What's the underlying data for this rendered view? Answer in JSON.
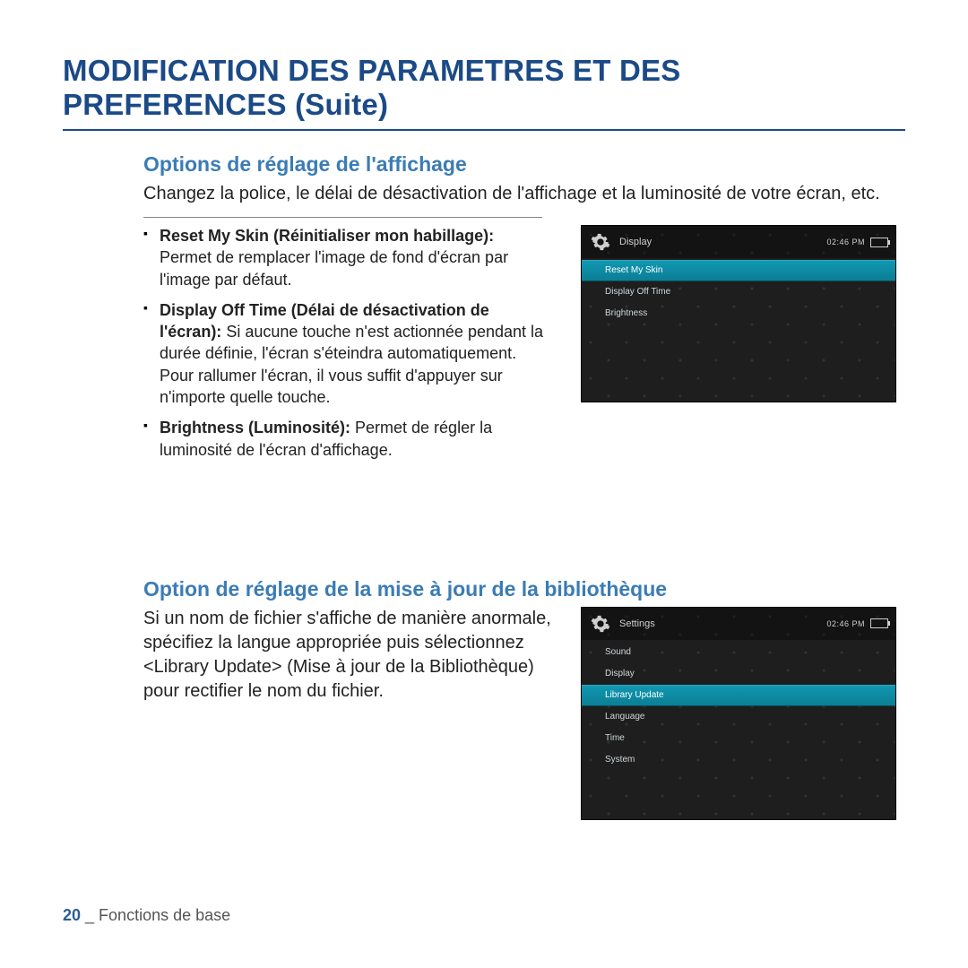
{
  "page_title": "MODIFICATION DES PARAMETRES ET DES PREFERENCES (Suite)",
  "section1": {
    "heading": "Options de réglage de l'affichage",
    "intro": "Changez la police, le délai de désactivation de l'affichage et la luminosité de votre écran, etc.",
    "bullets": [
      {
        "bold": "Reset My Skin (Réinitialiser mon habillage):",
        "text": " Permet de remplacer l'image de fond d'écran par l'image par défaut."
      },
      {
        "bold": "Display Off Time (Délai de désactivation de l'écran):",
        "text": " Si aucune touche n'est actionnée pendant la durée définie, l'écran s'éteindra automatiquement. Pour rallumer l'écran, il vous suffit d'appuyer sur n'importe quelle touche."
      },
      {
        "bold": "Brightness (Luminosité):",
        "text": " Permet de régler la luminosité de l'écran d'affichage."
      }
    ],
    "device": {
      "title": "Display",
      "time": "02:46 PM",
      "items": [
        {
          "label": "Reset My Skin",
          "selected": true
        },
        {
          "label": "Display Off Time",
          "selected": false
        },
        {
          "label": "Brightness",
          "selected": false
        }
      ]
    }
  },
  "section2": {
    "heading": "Option de réglage de la mise à jour de la bibliothèque",
    "intro": "Si un nom de fichier s'affiche de manière anormale, spécifiez la langue appropriée puis sélectionnez <Library Update> (Mise à jour de la Bibliothèque) pour rectifier le nom du fichier.",
    "device": {
      "title": "Settings",
      "time": "02:46 PM",
      "items": [
        {
          "label": "Sound",
          "selected": false
        },
        {
          "label": "Display",
          "selected": false
        },
        {
          "label": "Library Update",
          "selected": true
        },
        {
          "label": "Language",
          "selected": false
        },
        {
          "label": "Time",
          "selected": false
        },
        {
          "label": "System",
          "selected": false
        }
      ]
    }
  },
  "footer": {
    "page_number": "20",
    "separator": " _ ",
    "section_name": "Fonctions de base"
  }
}
